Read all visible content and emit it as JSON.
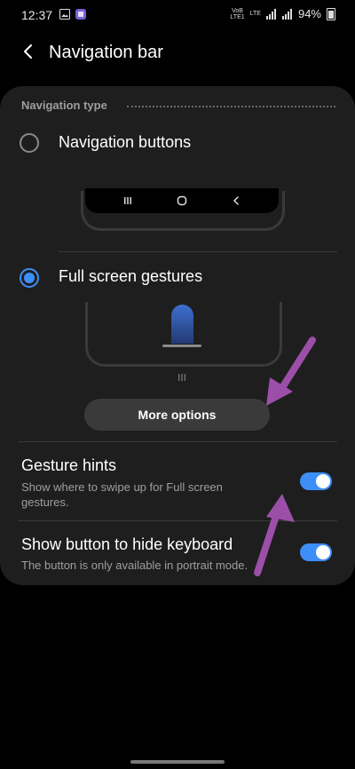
{
  "status_bar": {
    "time": "12:37",
    "volte_top": "VoB",
    "volte_bottom": "LTE1",
    "network": "LTE",
    "battery": "94%"
  },
  "header": {
    "title": "Navigation bar",
    "back_icon": "back-arrow-icon"
  },
  "section": {
    "label": "Navigation type"
  },
  "options": {
    "nav_buttons": {
      "label": "Navigation buttons",
      "selected": false
    },
    "gestures": {
      "label": "Full screen gestures",
      "selected": true
    }
  },
  "more_options": {
    "label": "More options"
  },
  "gesture_hints": {
    "title": "Gesture hints",
    "subtitle": "Show where to swipe up for Full screen gestures.",
    "enabled": true
  },
  "hide_keyboard": {
    "title": "Show button to hide keyboard",
    "subtitle": "The button is only available in portrait mode.",
    "enabled": true
  },
  "colors": {
    "accent": "#3e8ef7",
    "annotation_arrow": "#9b4fa8",
    "card": "#1e1e1e"
  }
}
